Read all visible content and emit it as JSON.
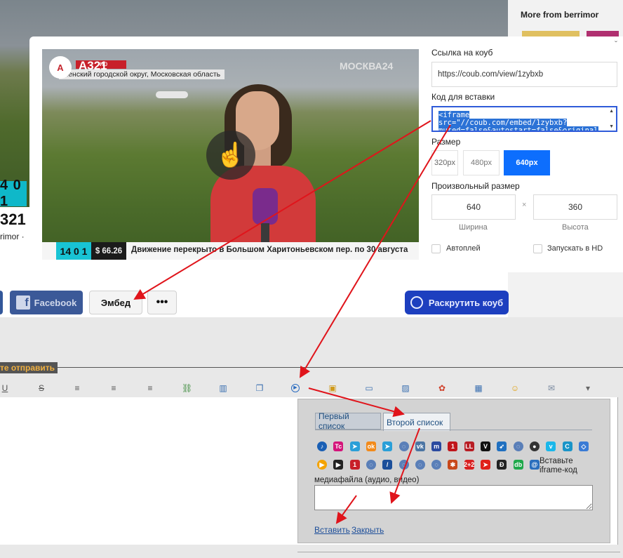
{
  "background_page": {
    "more_from": "More from berrimor",
    "badge": "4 0 1",
    "title_fragment": "321",
    "author_fragment": "rimor ·",
    "buttons": {
      "facebook": "Facebook",
      "embed": "Эмбед",
      "more": "•••",
      "promote": "Раскрутить коуб"
    }
  },
  "modal": {
    "video": {
      "logo_text": "A",
      "plane_label": "A321",
      "red_tag": "ир",
      "location": "менский городской округ, Московская область",
      "channel": "МОСКВА24",
      "time": "14 0 1",
      "usd": "$ 66.26",
      "ticker": "Движение перекрыто в Большом Харитоньевском пер. по 30 августа"
    },
    "link_label": "Ссылка на коуб",
    "link_value": "https://coub.com/view/1zybxb",
    "embed_code_label": "Код для вставки",
    "embed_code_lines": [
      "<iframe",
      "src=\"//coub.com/embed/1zybxb?",
      "muted=false&autostart=false&original"
    ],
    "size_label": "Размер",
    "sizes": [
      "320px",
      "480px",
      "640px"
    ],
    "selected_size": "640px",
    "custom_size_label": "Произвольный размер",
    "width_value": "640",
    "height_value": "360",
    "times_sign": "×",
    "width_caption": "Ширина",
    "height_caption": "Высота",
    "autoplay_label": "Автоплей",
    "hd_label": "Запускать в HD",
    "close_icon": "ˇ"
  },
  "forum": {
    "send_label": "те отправить",
    "toolbar_glyphs": {
      "underline": "U",
      "strike": "S",
      "align_left": "≡",
      "align_center": "≡",
      "align_right": "≡",
      "link": "⛓",
      "book": "▥",
      "window": "❐",
      "media": "▶",
      "lock": "▣",
      "comment": "▭",
      "image": "▨",
      "flower": "✿",
      "table": "▦",
      "smiley": "☺",
      "mail": "✉",
      "dropdown": "▾"
    },
    "popup": {
      "tab1": "Первый список",
      "tab2": "Второй список",
      "embed_iframe_label": "Вставьте iframe-код",
      "media_label": "медиафайла (аудио, видео)",
      "insert_link": "Вставить",
      "close_link": "Закрыть",
      "row1_icons": [
        {
          "name": "player-icon",
          "color": "#1a5fb4",
          "glyph": "♪",
          "round": true
        },
        {
          "name": "tc-icon",
          "color": "#d4147a",
          "glyph": "Tc"
        },
        {
          "name": "telegram-icon",
          "color": "#2a9fd8",
          "glyph": "➤"
        },
        {
          "name": "ok-icon",
          "color": "#f28a1a",
          "glyph": "ok"
        },
        {
          "name": "telegram-icon-2",
          "color": "#2a9fd8",
          "glyph": "➤"
        },
        {
          "name": "globe-icon",
          "color": "#5a7fb8",
          "glyph": "◌",
          "round": true
        },
        {
          "name": "vk-icon",
          "color": "#4c75a3",
          "glyph": "vk"
        },
        {
          "name": "m-icon",
          "color": "#2b4aa0",
          "glyph": "m"
        },
        {
          "name": "channel-one-icon",
          "color": "#c0161b",
          "glyph": "1"
        },
        {
          "name": "ll-icon",
          "color": "#b81d24",
          "glyph": "LL"
        },
        {
          "name": "v-icon",
          "color": "#111111",
          "glyph": "V"
        },
        {
          "name": "arrow-icon",
          "color": "#2070c0",
          "glyph": "➶"
        },
        {
          "name": "globe-icon-2",
          "color": "#5a7fb8",
          "glyph": "◌",
          "round": true
        },
        {
          "name": "eye-icon",
          "color": "#333333",
          "glyph": "●",
          "round": true
        },
        {
          "name": "vimeo-icon",
          "color": "#1ab7ea",
          "glyph": "v"
        },
        {
          "name": "c-icon",
          "color": "#1a94c8",
          "glyph": "C"
        },
        {
          "name": "shield-icon",
          "color": "#3a7bd5",
          "glyph": "◇"
        }
      ],
      "row2_icons": [
        {
          "name": "play-orange-icon",
          "color": "#f4a300",
          "glyph": "▶",
          "round": true
        },
        {
          "name": "play-black-icon",
          "color": "#222222",
          "glyph": "▶"
        },
        {
          "name": "russia-one-icon",
          "color": "#c8202a",
          "glyph": "1"
        },
        {
          "name": "globe-icon-3",
          "color": "#5a7fb8",
          "glyph": "◌",
          "round": true
        },
        {
          "name": "slash-icon",
          "color": "#1c4f9a",
          "glyph": "/"
        },
        {
          "name": "globe-icon-4",
          "color": "#5a7fb8",
          "glyph": "◌",
          "round": true
        },
        {
          "name": "globe-icon-5",
          "color": "#5a7fb8",
          "glyph": "◌",
          "round": true
        },
        {
          "name": "globe-icon-6",
          "color": "#5a7fb8",
          "glyph": "◌",
          "round": true
        },
        {
          "name": "star-icon",
          "color": "#c8481a",
          "glyph": "✱"
        },
        {
          "name": "ren-icon",
          "color": "#d82020",
          "glyph": "2+2"
        },
        {
          "name": "red-arrow-icon",
          "color": "#e0201a",
          "glyph": "➤"
        },
        {
          "name": "d-icon",
          "color": "#222222",
          "glyph": "Ð"
        },
        {
          "name": "green-icon",
          "color": "#1fa84a",
          "glyph": "db"
        },
        {
          "name": "at-icon",
          "color": "#2a6ebd",
          "glyph": "@"
        }
      ]
    }
  }
}
